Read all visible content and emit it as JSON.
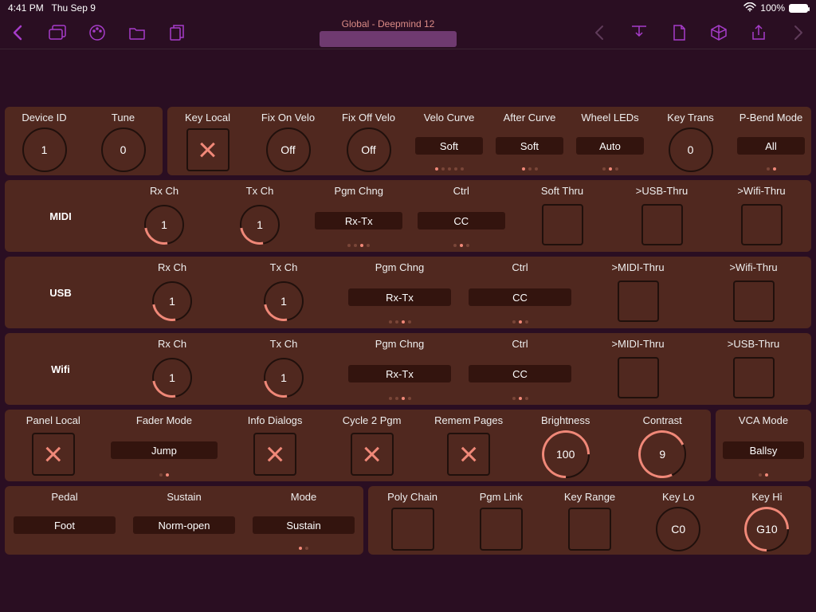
{
  "status": {
    "time": "4:41 PM",
    "date": "Thu Sep 9",
    "battery": "100%"
  },
  "title": "Global - Deepmind 12",
  "row1": {
    "device_id": {
      "label": "Device ID",
      "value": "1"
    },
    "tune": {
      "label": "Tune",
      "value": "0"
    },
    "key_local": {
      "label": "Key Local"
    },
    "fix_on": {
      "label": "Fix On Velo",
      "value": "Off"
    },
    "fix_off": {
      "label": "Fix Off Velo",
      "value": "Off"
    },
    "velo_curve": {
      "label": "Velo Curve",
      "value": "Soft"
    },
    "after_curve": {
      "label": "After Curve",
      "value": "Soft"
    },
    "wheel_leds": {
      "label": "Wheel LEDs",
      "value": "Auto"
    },
    "key_trans": {
      "label": "Key Trans",
      "value": "0"
    },
    "pbend_mode": {
      "label": "P-Bend Mode",
      "value": "All"
    }
  },
  "midi": {
    "label": "MIDI",
    "rx": {
      "label": "Rx Ch",
      "value": "1"
    },
    "tx": {
      "label": "Tx Ch",
      "value": "1"
    },
    "pgm": {
      "label": "Pgm Chng",
      "value": "Rx-Tx"
    },
    "ctrl": {
      "label": "Ctrl",
      "value": "CC"
    },
    "soft_thru": {
      "label": "Soft Thru"
    },
    "usb_thru": {
      "label": ">USB-Thru"
    },
    "wifi_thru": {
      "label": ">Wifi-Thru"
    }
  },
  "usb": {
    "label": "USB",
    "rx": {
      "label": "Rx Ch",
      "value": "1"
    },
    "tx": {
      "label": "Tx Ch",
      "value": "1"
    },
    "pgm": {
      "label": "Pgm Chng",
      "value": "Rx-Tx"
    },
    "ctrl": {
      "label": "Ctrl",
      "value": "CC"
    },
    "midi_thru": {
      "label": ">MIDI-Thru"
    },
    "wifi_thru": {
      "label": ">Wifi-Thru"
    }
  },
  "wifi": {
    "label": "Wifi",
    "rx": {
      "label": "Rx Ch",
      "value": "1"
    },
    "tx": {
      "label": "Tx Ch",
      "value": "1"
    },
    "pgm": {
      "label": "Pgm Chng",
      "value": "Rx-Tx"
    },
    "ctrl": {
      "label": "Ctrl",
      "value": "CC"
    },
    "midi_thru": {
      "label": ">MIDI-Thru"
    },
    "usb_thru": {
      "label": ">USB-Thru"
    }
  },
  "row5a": {
    "panel_local": {
      "label": "Panel Local"
    },
    "fader_mode": {
      "label": "Fader Mode",
      "value": "Jump"
    },
    "info_dlg": {
      "label": "Info Dialogs"
    },
    "cycle2": {
      "label": "Cycle 2 Pgm"
    },
    "remem": {
      "label": "Remem Pages"
    },
    "brightness": {
      "label": "Brightness",
      "value": "100"
    },
    "contrast": {
      "label": "Contrast",
      "value": "9"
    }
  },
  "row5b": {
    "vca_mode": {
      "label": "VCA Mode",
      "value": "Ballsy"
    }
  },
  "row6a": {
    "pedal": {
      "label": "Pedal",
      "value": "Foot"
    },
    "sustain": {
      "label": "Sustain",
      "value": "Norm-open"
    },
    "mode": {
      "label": "Mode",
      "value": "Sustain"
    }
  },
  "row6b": {
    "poly": {
      "label": "Poly Chain"
    },
    "pgmlnk": {
      "label": "Pgm Link"
    },
    "krange": {
      "label": "Key Range"
    },
    "keylo": {
      "label": "Key Lo",
      "value": "C0"
    },
    "keyhi": {
      "label": "Key Hi",
      "value": "G10"
    }
  }
}
